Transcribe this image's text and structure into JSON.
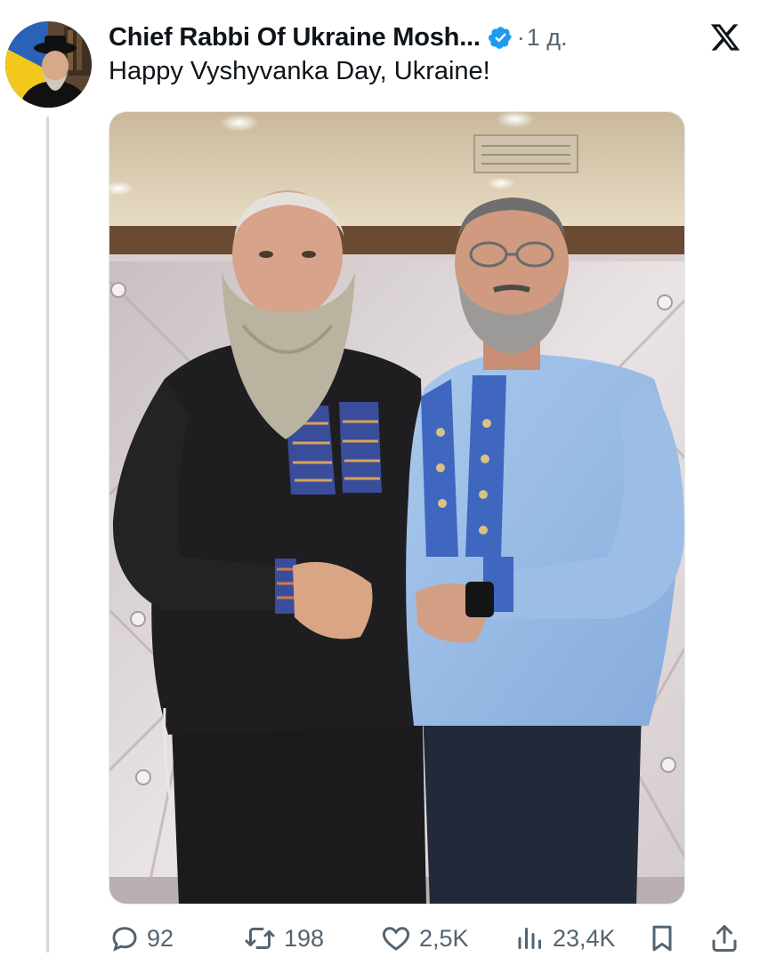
{
  "post": {
    "author_name": "Chief Rabbi Of Ukraine Mosh...",
    "verified": true,
    "separator": "·",
    "time": "1 д.",
    "text": "Happy Vyshyvanka Day, Ukraine!"
  },
  "metrics": {
    "replies": "92",
    "reposts": "198",
    "likes": "2,5K",
    "views": "23,4K"
  },
  "icons": {
    "close": "x-logo-icon",
    "reply": "comment-icon",
    "repost": "repost-icon",
    "like": "heart-icon",
    "views": "views-chart-icon",
    "bookmark": "bookmark-icon",
    "share": "share-icon",
    "verified": "verified-badge-icon"
  },
  "colors": {
    "text": "#0f1419",
    "secondary": "#536471",
    "verified": "#1d9bf0",
    "thread_line": "#cfd9de"
  }
}
